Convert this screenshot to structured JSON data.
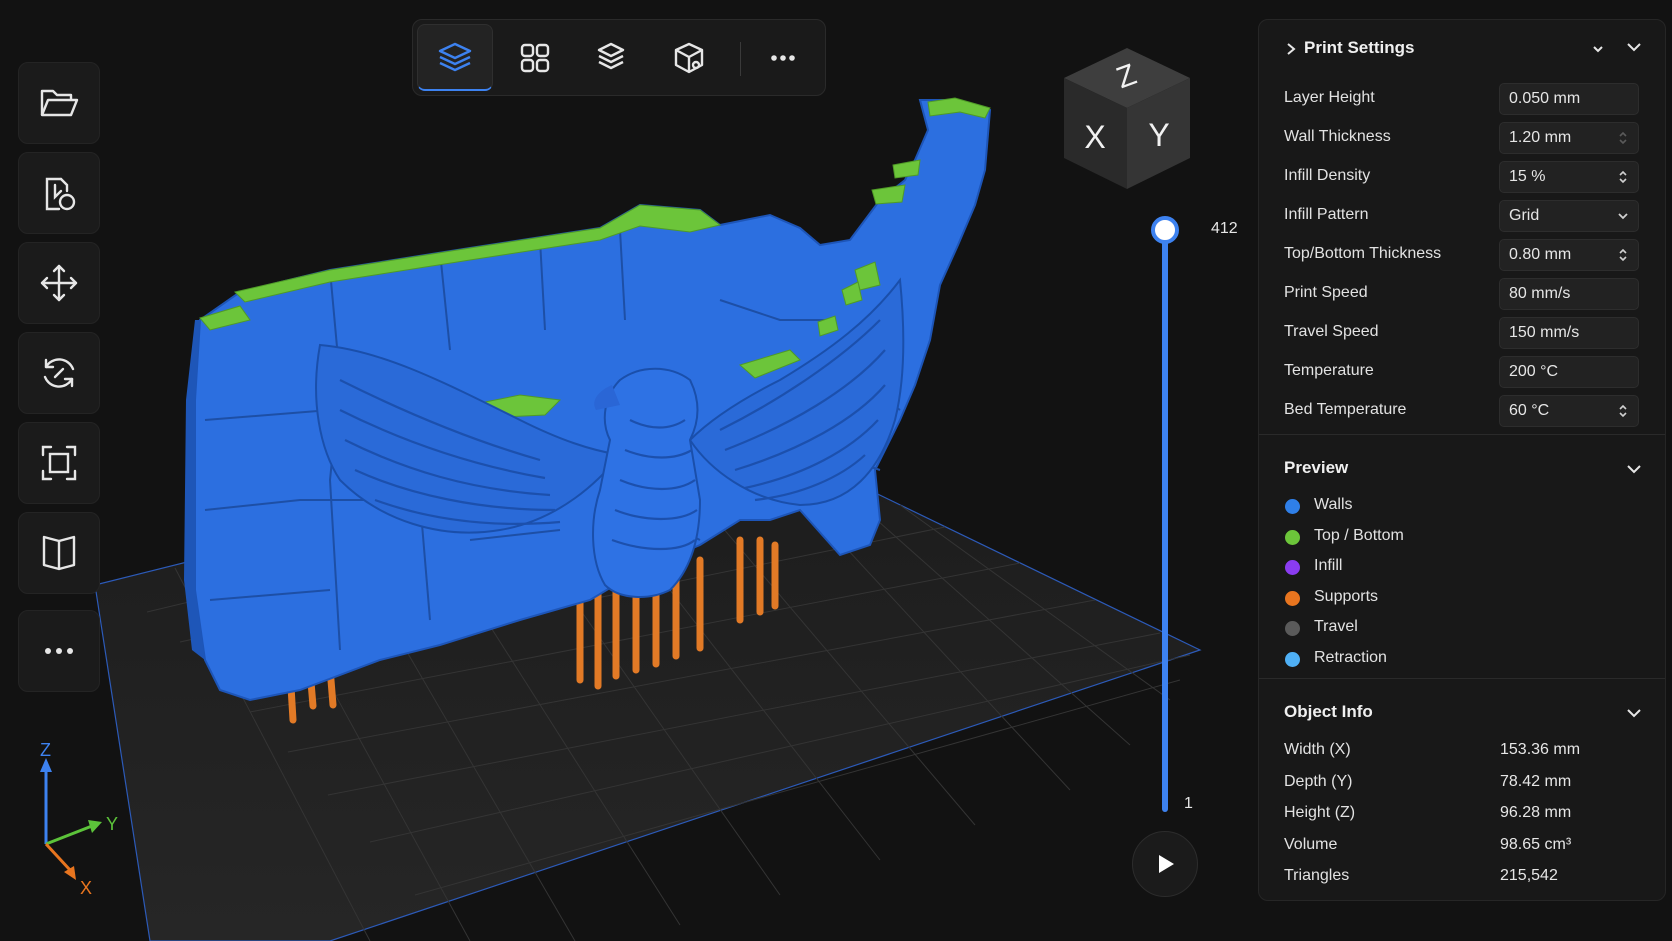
{
  "toolbar_left": {
    "items": [
      {
        "icon": "folder-open-icon"
      },
      {
        "icon": "import-model-icon"
      },
      {
        "icon": "move-icon"
      },
      {
        "icon": "rotate-icon"
      },
      {
        "icon": "scale-icon"
      },
      {
        "icon": "mirror-icon"
      },
      {
        "icon": "more-horizontal-icon"
      }
    ]
  },
  "toolbar_top": {
    "items": [
      {
        "icon": "layers-view-icon",
        "active": true
      },
      {
        "icon": "grid-view-icon"
      },
      {
        "icon": "layer-stack-icon"
      },
      {
        "icon": "cube-view-icon"
      },
      {
        "icon": "more-horizontal-icon"
      }
    ]
  },
  "view_cube": {
    "top": "Z",
    "left": "X",
    "right": "Y"
  },
  "layer_slider": {
    "max_label": "412",
    "min_label": "1",
    "current_layer": 412,
    "max": 412
  },
  "axis_indicator": {
    "z": "Z",
    "y": "Y",
    "x": "X"
  },
  "panel": {
    "print_settings": {
      "title": "Print Settings",
      "items": [
        {
          "label": "Layer Height",
          "value": "0.050 mm",
          "control": "none"
        },
        {
          "label": "Wall Thickness",
          "value": "1.20 mm",
          "control": "stepper-faint"
        },
        {
          "label": "Infill Density",
          "value": "15 %",
          "control": "stepper"
        },
        {
          "label": "Infill Pattern",
          "value": "Grid",
          "control": "dropdown"
        },
        {
          "label": "Top/Bottom Thickness",
          "value": "0.80 mm",
          "control": "stepper"
        },
        {
          "label": "Print Speed",
          "value": "80 mm/s",
          "control": "none"
        },
        {
          "label": "Travel Speed",
          "value": "150 mm/s",
          "control": "none"
        },
        {
          "label": "Temperature",
          "value": "200 °C",
          "control": "none"
        },
        {
          "label": "Bed Temperature",
          "value": "60 °C",
          "control": "stepper"
        }
      ]
    },
    "preview": {
      "title": "Preview",
      "legend": [
        {
          "label": "Walls",
          "color": "#2f7fe8"
        },
        {
          "label": "Top / Bottom",
          "color": "#6cc53a"
        },
        {
          "label": "Infill",
          "color": "#8a3cf0"
        },
        {
          "label": "Supports",
          "color": "#e8751f"
        },
        {
          "label": "Travel",
          "color": "#5a5a5a"
        },
        {
          "label": "Retraction",
          "color": "#4fb0f5"
        }
      ]
    },
    "object_info": {
      "title": "Object Info",
      "items": [
        {
          "label": "Width (X)",
          "value": "153.36 mm"
        },
        {
          "label": "Depth (Y)",
          "value": "78.42 mm"
        },
        {
          "label": "Height (Z)",
          "value": "96.28 mm"
        },
        {
          "label": "Volume",
          "value": "98.65 cm³"
        },
        {
          "label": "Triangles",
          "value": "215,542"
        }
      ]
    }
  },
  "colors": {
    "accent": "#3d82f0",
    "model_walls": "#2f6fe0",
    "top_bottom": "#6cc53a",
    "supports": "#e8751f"
  }
}
